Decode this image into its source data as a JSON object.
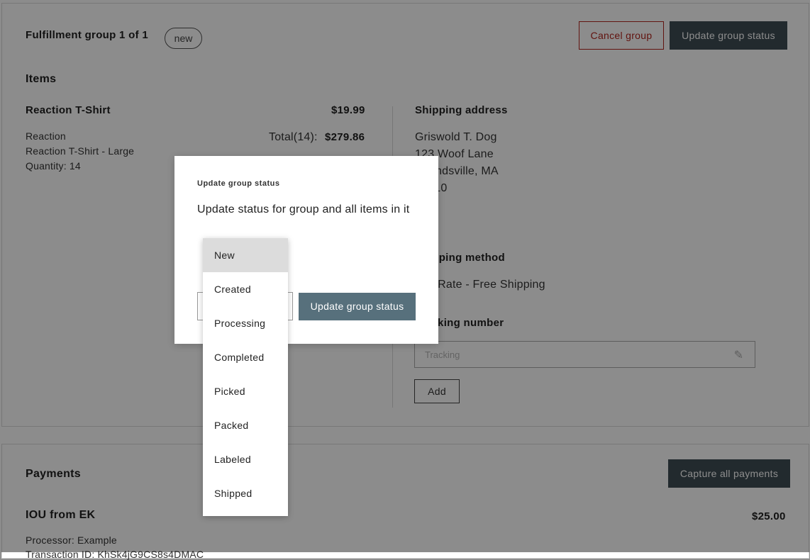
{
  "fulfillment": {
    "title": "Fulfillment group 1 of 1",
    "status_badge": "new",
    "cancel_button": "Cancel group",
    "update_button": "Update group status",
    "items_heading": "Items",
    "item": {
      "name": "Reaction T-Shirt",
      "price": "$19.99",
      "vendor": "Reaction",
      "variant": "Reaction T-Shirt - Large",
      "quantity": "Quantity: 14",
      "total_label": "Total(14):",
      "total_value": "$279.86"
    },
    "shipping_address": {
      "heading": "Shipping address",
      "line1": "Griswold T. Dog",
      "line2": "123 Woof Lane",
      "line3": "Pupndsville, MA",
      "line4": "01010"
    },
    "shipping_method": {
      "heading": "Shipping method",
      "value": "Flat Rate - Free Shipping"
    },
    "tracking": {
      "heading": "Tracking number",
      "placeholder": "Tracking",
      "add_button": "Add",
      "icon": "pencil-icon"
    }
  },
  "payments": {
    "heading": "Payments",
    "capture_button": "Capture all payments",
    "payment_name": "IOU from EK",
    "payment_amount": "$25.00",
    "processor": "Processor: Example",
    "transaction": "Transaction ID: KhSk4jG9CS8s4DMAC"
  },
  "modal": {
    "kicker": "Update group status",
    "description": "Update status for group and all items in it",
    "submit_button": "Update group status",
    "selected_option": "New",
    "options": [
      "New",
      "Created",
      "Processing",
      "Completed",
      "Picked",
      "Packed",
      "Labeled",
      "Shipped"
    ]
  }
}
